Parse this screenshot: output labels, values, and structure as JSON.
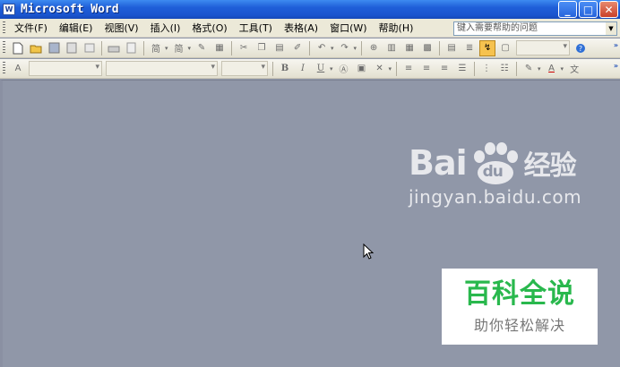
{
  "window": {
    "title": "Microsoft Word",
    "icon": "word-icon"
  },
  "window_controls": {
    "minimize": "_",
    "maximize": "□",
    "close": "✕"
  },
  "menu": [
    {
      "label": "文件(F)"
    },
    {
      "label": "编辑(E)"
    },
    {
      "label": "视图(V)"
    },
    {
      "label": "插入(I)"
    },
    {
      "label": "格式(O)"
    },
    {
      "label": "工具(T)"
    },
    {
      "label": "表格(A)"
    },
    {
      "label": "窗口(W)"
    },
    {
      "label": "帮助(H)"
    }
  ],
  "help_search": {
    "placeholder": "键入需要帮助的问题"
  },
  "toolbar_standard": {
    "icons": [
      "new-icon",
      "open-icon",
      "save-icon",
      "permission-icon",
      "email-icon",
      "print-icon",
      "print-preview-icon",
      "spelling-icon",
      "research-icon",
      "cut-icon",
      "copy-icon",
      "paste-icon",
      "format-painter-icon",
      "undo-icon",
      "redo-icon",
      "hyperlink-icon",
      "tables-borders-icon",
      "insert-table-icon",
      "insert-excel-icon",
      "columns-icon",
      "drawing-icon",
      "document-map-icon",
      "show-hide-icon"
    ]
  },
  "toolbar_format": {
    "icons": [
      "bold-icon",
      "italic-icon",
      "underline-icon",
      "char-border-icon",
      "char-shading-icon",
      "char-scale-icon",
      "align-left-icon",
      "center-icon",
      "align-right-icon",
      "justify-icon",
      "numbering-icon",
      "bullets-icon",
      "highlight-icon",
      "font-color-icon",
      "phonetic-guide-icon"
    ],
    "bold": "B",
    "italic": "I",
    "underline": "U",
    "font_color": "A"
  },
  "watermark": {
    "brand_latin_1": "Bai",
    "brand_paw": "du",
    "brand_cn": "经验",
    "url": "jingyan.baidu.com"
  },
  "badge": {
    "title": "百科全说",
    "subtitle": "助你轻松解决"
  },
  "colors": {
    "titlebar": "#1f5ed8",
    "workspace": "#9097a8",
    "badge_green": "#29b84d",
    "highlight": "#f6c24f"
  }
}
